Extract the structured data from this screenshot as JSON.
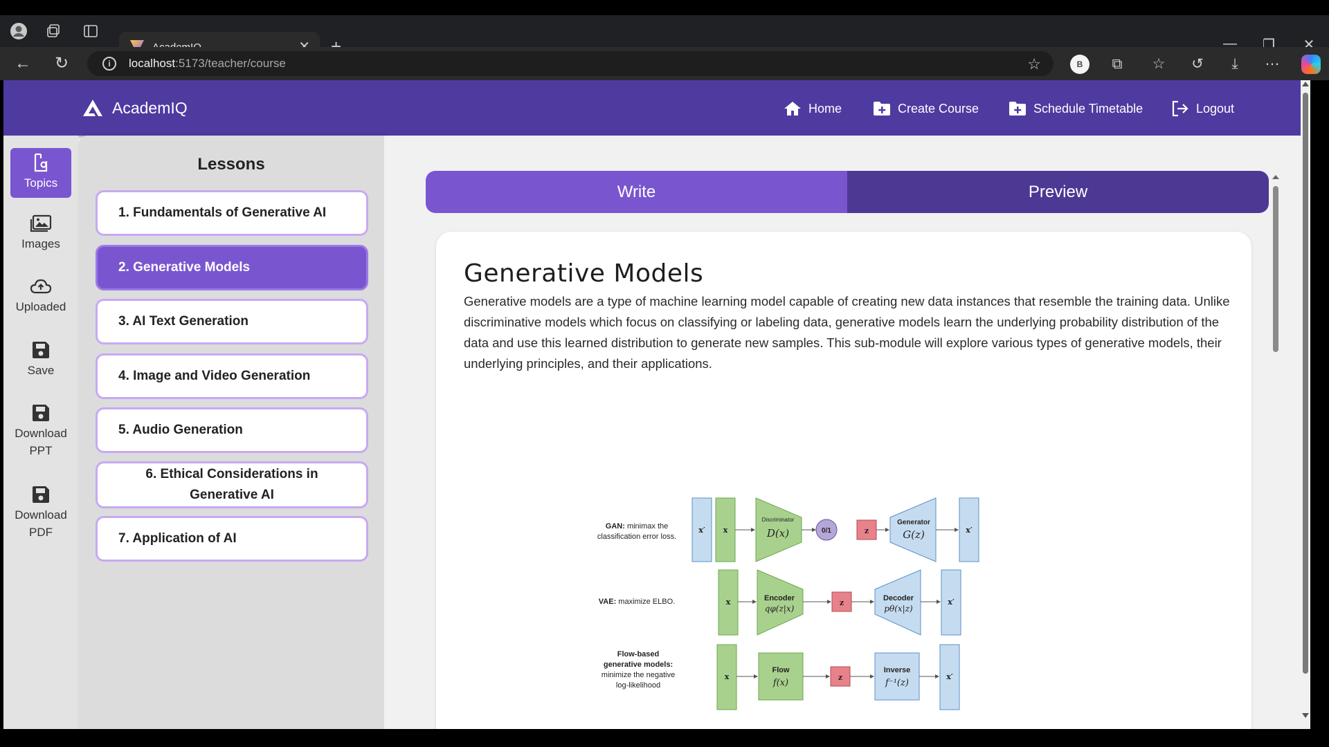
{
  "browser": {
    "tab_title": "AcademIQ",
    "url_host": "localhost",
    "url_path": ":5173/teacher/course",
    "profile_initial": "B"
  },
  "app": {
    "logo_text": "AcademIQ",
    "nav": [
      {
        "label": "Home",
        "icon": "home-icon"
      },
      {
        "label": "Create Course",
        "icon": "folder-plus-icon"
      },
      {
        "label": "Schedule Timetable",
        "icon": "folder-plus-icon"
      },
      {
        "label": "Logout",
        "icon": "logout-icon"
      }
    ]
  },
  "tools": [
    {
      "label": "Topics",
      "icon": "topics-icon",
      "active": true
    },
    {
      "label": "Images",
      "icon": "image-icon"
    },
    {
      "label": "Uploaded",
      "icon": "cloud-upload-icon"
    },
    {
      "label": "Save",
      "icon": "save-icon"
    },
    {
      "label": "Download PPT",
      "line1": "Download",
      "line2": "PPT",
      "icon": "save-icon"
    },
    {
      "label": "Download PDF",
      "line1": "Download",
      "line2": "PDF",
      "icon": "save-icon"
    }
  ],
  "lessons": {
    "title": "Lessons",
    "items": [
      "1. Fundamentals of Generative AI",
      "2. Generative Models",
      "3. AI Text Generation",
      "4. Image and Video Generation",
      "5. Audio Generation",
      "6. Ethical Considerations in Generative AI",
      "7. Application of AI"
    ],
    "item6_line1": "6. Ethical Considerations in",
    "item6_line2": "Generative AI",
    "selected_index": 1
  },
  "editor": {
    "tab_write": "Write",
    "tab_preview": "Preview",
    "doc_title": "Generative Models",
    "doc_body": "Generative models are a type of machine learning model capable of creating new data instances that resemble the training data. Unlike discriminative models which focus on classifying or labeling data, generative models learn the underlying probability distribution of the data and use this learned distribution to generate new samples. This sub-module will explore various types of generative models, their underlying principles, and their applications."
  },
  "figure": {
    "gan_label_bold": "GAN:",
    "gan_label_rest1": "minimax the",
    "gan_label_rest2": "classification error loss.",
    "vae_label_bold": "VAE:",
    "vae_label_rest": "maximize ELBO.",
    "flow_label_line1": "Flow-based",
    "flow_label_line2": "generative models:",
    "flow_label_line3": "minimize the negative",
    "flow_label_line4": "log-likelihood",
    "discriminator": "Discriminator",
    "discriminator_fn": "D(x)",
    "generator": "Generator",
    "generator_fn": "G(z)",
    "encoder": "Encoder",
    "encoder_fn": "qφ(z|x)",
    "decoder": "Decoder",
    "decoder_fn": "pθ(x|z)",
    "flow": "Flow",
    "flow_fn": "f(x)",
    "inverse": "Inverse",
    "inverse_fn": "f⁻¹(z)",
    "x": "x",
    "x_prime": "x′",
    "z": "z",
    "binary": "0/1"
  },
  "colors": {
    "appbar": "#4f3aa0",
    "accent": "#7a55d0",
    "preview_tab": "#4d3894",
    "lesson_border": "#c7a9f2",
    "fig_green": "#a9d18e",
    "fig_blue": "#c5dcf0",
    "fig_red": "#e8828a",
    "fig_purple": "#b4a7d6"
  }
}
